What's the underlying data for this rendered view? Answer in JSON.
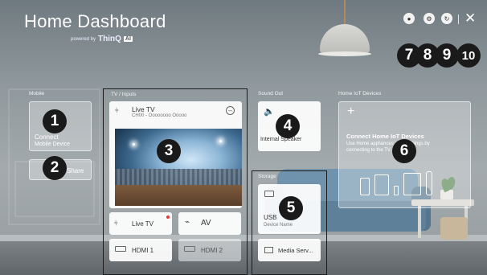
{
  "header": {
    "title": "Home Dashboard",
    "powered_by": "powered by",
    "brand": "ThinQ",
    "ai_badge": "AI"
  },
  "top_icons": [
    {
      "name": "account-icon",
      "glyph": "●"
    },
    {
      "name": "settings-icon",
      "glyph": "⚙"
    },
    {
      "name": "refresh-icon",
      "glyph": "↻"
    }
  ],
  "close_glyph": "✕",
  "sections": {
    "mobile": "Mobile",
    "tv_inputs": "TV / Inputs",
    "sound_out": "Sound Out",
    "storage": "Storage",
    "home_iot": "Home IoT Devices"
  },
  "mobile": {
    "connect_label": "Connect",
    "connect_sub": "Mobile Device",
    "share_label": "Share"
  },
  "tv": {
    "live_title": "Live TV",
    "channel": "CH00 - Oooooooo Ooooo",
    "inputs": [
      {
        "label": "Live TV",
        "active_dot": true
      },
      {
        "label": "AV",
        "active_dot": false
      },
      {
        "label": "HDMI 1",
        "active_dot": false
      },
      {
        "label": "HDMI 2",
        "active_dot": false
      }
    ]
  },
  "sound": {
    "label": "Internal Speaker"
  },
  "storage": {
    "usb_label": "USB",
    "usb_sub": "Device Name",
    "media_label": "Media Serv..."
  },
  "iot": {
    "plus": "+",
    "title": "Connect Home IoT Devices",
    "desc": "Use Home appliances and all things by connecting to the TV."
  },
  "callouts": [
    "1",
    "2",
    "3",
    "4",
    "5",
    "6",
    "7",
    "8",
    "9",
    "10"
  ]
}
